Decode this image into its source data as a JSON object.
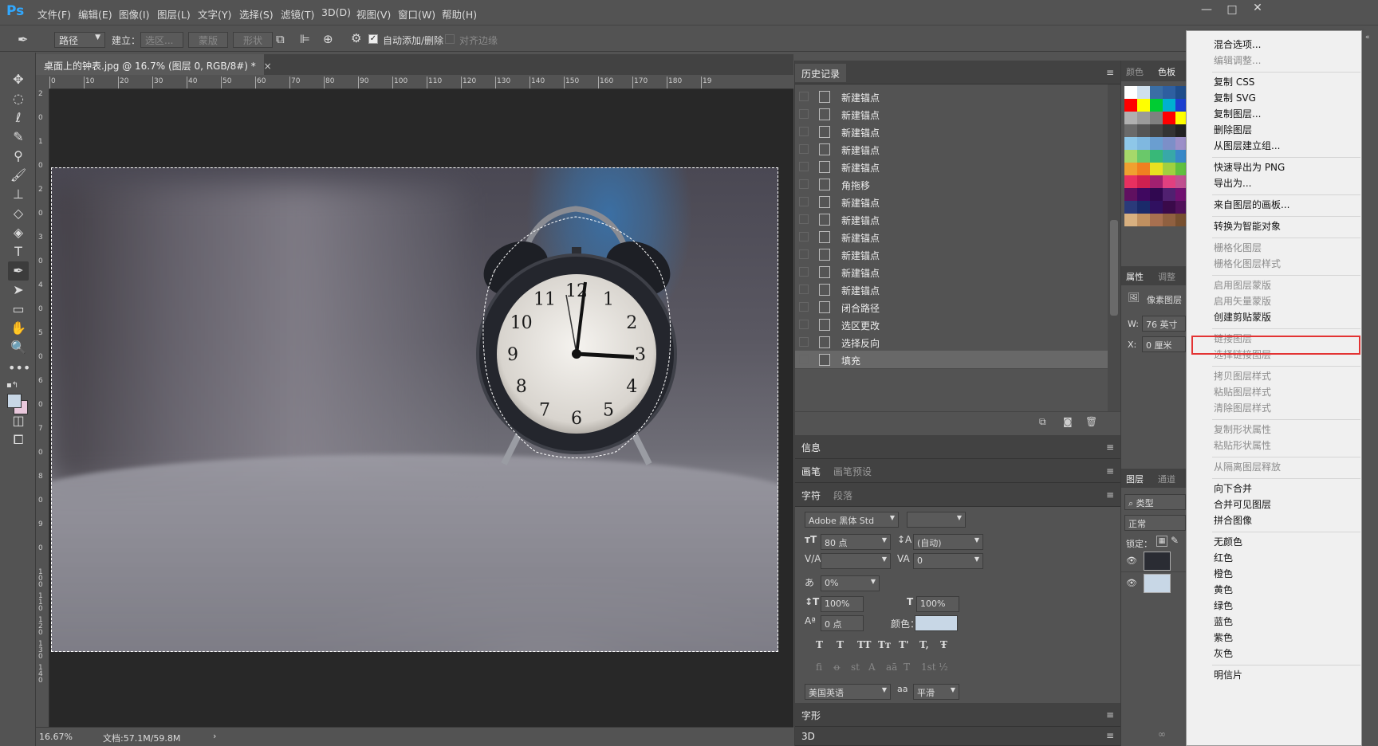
{
  "menubar": {
    "logo": "Ps",
    "items": [
      "文件(F)",
      "编辑(E)",
      "图像(I)",
      "图层(L)",
      "文字(Y)",
      "选择(S)",
      "滤镜(T)",
      "3D(D)",
      "视图(V)",
      "窗口(W)",
      "帮助(H)"
    ],
    "win_min": "—",
    "win_max": "□",
    "win_close": "✕"
  },
  "options": {
    "mode": "路径",
    "build_label": "建立：",
    "build_selection": "选区...",
    "build_mask": "蒙版",
    "build_shape": "形状",
    "auto_add_delete": "自动添加/删除",
    "align_edges": "对齐边缘"
  },
  "document": {
    "tab_title": "桌面上的钟表.jpg @ 16.7% (图层 0, RGB/8#) *",
    "zoom": "16.67%",
    "doc_size": "文档:57.1M/59.8M",
    "ruler_top": [
      "0",
      "10",
      "20",
      "30",
      "40",
      "50",
      "60",
      "70",
      "80",
      "90",
      "100",
      "110",
      "120",
      "130",
      "140",
      "150",
      "160",
      "170",
      "180",
      "19"
    ],
    "ruler_left": [
      "2",
      "0",
      "1",
      "0",
      "2",
      "0",
      "3",
      "0",
      "4",
      "0",
      "5",
      "0",
      "6",
      "0",
      "7",
      "0",
      "8",
      "0",
      "9",
      "0",
      "1 0 0",
      "1 1 0",
      "1 2 0",
      "1 3 0",
      "1 4 0"
    ]
  },
  "clock_numbers": [
    "12",
    "1",
    "2",
    "3",
    "4",
    "5",
    "6",
    "7",
    "8",
    "9",
    "10",
    "11"
  ],
  "history": {
    "title": "历史记录",
    "items": [
      "新建锚点",
      "新建锚点",
      "新建锚点",
      "新建锚点",
      "新建锚点",
      "角拖移",
      "新建锚点",
      "新建锚点",
      "新建锚点",
      "新建锚点",
      "新建锚点",
      "新建锚点",
      "闭合路径",
      "选区更改",
      "选择反向",
      "填充"
    ]
  },
  "panels": {
    "info": "信息",
    "brush": "画笔",
    "brush_presets": "画笔预设",
    "character": "字符",
    "paragraph": "段落",
    "glyphs": "字形",
    "threeD": "3D"
  },
  "character": {
    "font": "Adobe 黑体 Std",
    "size": "80 点",
    "leading": "(自动)",
    "tracking": "0",
    "scale_pct": "0%",
    "vscale": "100%",
    "hscale": "100%",
    "baseline": "0 点",
    "color_label": "颜色：",
    "color": "#c8d7e6",
    "language": "美国英语",
    "aa_label": "aa",
    "aa": "平滑",
    "style_buttons": [
      "T",
      "T",
      "TT",
      "Tт",
      "T'",
      "T,",
      "Ŧ"
    ],
    "ot_buttons": [
      "fi",
      "ꝋ",
      "st",
      "A",
      "aā",
      "T",
      "1st",
      "½"
    ]
  },
  "right_panel": {
    "color_tab": "颜色",
    "swatches_tab": "色板",
    "props_tab": "属性",
    "adjust_tab": "调整",
    "pixel_layer": "像素图层",
    "w_label": "W:",
    "w_value": "76 英寸",
    "x_label": "X:",
    "x_value": "0 厘米",
    "layers_tab": "图层",
    "channels_tab": "通道",
    "filter_type": "类型",
    "blend_mode": "正常",
    "lock_label": "锁定："
  },
  "context_menu": {
    "items": [
      {
        "label": "混合选项...",
        "enabled": true
      },
      {
        "label": "编辑调整...",
        "enabled": false
      },
      {
        "label": "复制 CSS",
        "enabled": true
      },
      {
        "label": "复制 SVG",
        "enabled": true
      },
      {
        "label": "复制图层...",
        "enabled": true
      },
      {
        "label": "删除图层",
        "enabled": true
      },
      {
        "label": "从图层建立组...",
        "enabled": true
      },
      {
        "label": "快速导出为 PNG",
        "enabled": true
      },
      {
        "label": "导出为...",
        "enabled": true
      },
      {
        "label": "来自图层的画板...",
        "enabled": true
      },
      {
        "label": "转换为智能对象",
        "enabled": true
      },
      {
        "label": "栅格化图层",
        "enabled": false
      },
      {
        "label": "栅格化图层样式",
        "enabled": false
      },
      {
        "label": "启用图层蒙版",
        "enabled": false
      },
      {
        "label": "启用矢量蒙版",
        "enabled": false
      },
      {
        "label": "创建剪贴蒙版",
        "enabled": true
      },
      {
        "label": "链接图层",
        "enabled": false
      },
      {
        "label": "选择链接图层",
        "enabled": false
      },
      {
        "label": "拷贝图层样式",
        "enabled": false
      },
      {
        "label": "粘贴图层样式",
        "enabled": false
      },
      {
        "label": "清除图层样式",
        "enabled": false
      },
      {
        "label": "复制形状属性",
        "enabled": false
      },
      {
        "label": "粘贴形状属性",
        "enabled": false
      },
      {
        "label": "从隔离图层释放",
        "enabled": false
      },
      {
        "label": "向下合并",
        "enabled": true
      },
      {
        "label": "合并可见图层",
        "enabled": true
      },
      {
        "label": "拼合图像",
        "enabled": true
      },
      {
        "label": "无颜色",
        "enabled": true
      },
      {
        "label": "红色",
        "enabled": true
      },
      {
        "label": "橙色",
        "enabled": true
      },
      {
        "label": "黄色",
        "enabled": true
      },
      {
        "label": "绿色",
        "enabled": true
      },
      {
        "label": "蓝色",
        "enabled": true
      },
      {
        "label": "紫色",
        "enabled": true
      },
      {
        "label": "灰色",
        "enabled": true
      },
      {
        "label": "明信片",
        "enabled": true
      }
    ]
  },
  "colors": {
    "accent_highlight": "#e33333"
  }
}
